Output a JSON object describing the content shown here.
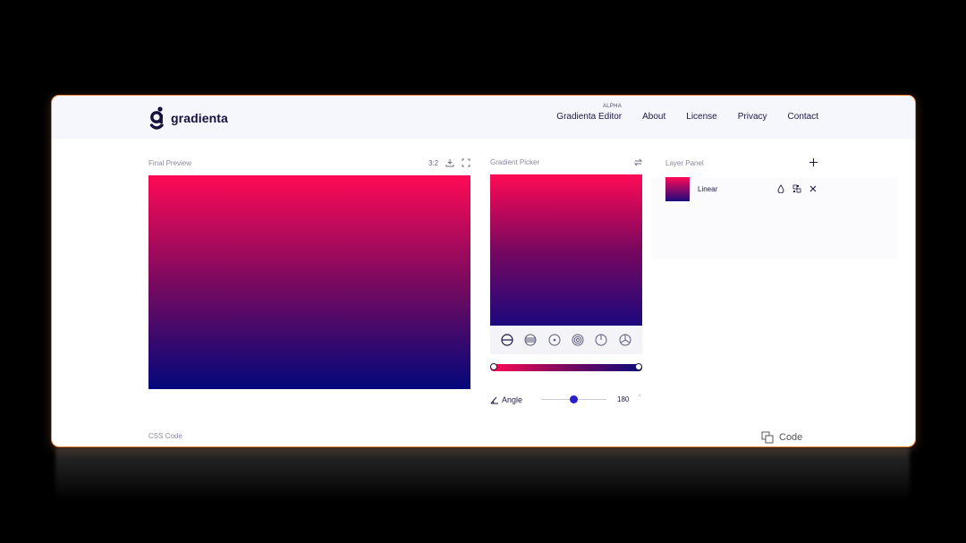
{
  "header": {
    "logo_text": "gradienta",
    "nav": [
      {
        "label": "Gradienta Editor",
        "badge": "ALPHA"
      },
      {
        "label": "About"
      },
      {
        "label": "License"
      },
      {
        "label": "Privacy"
      },
      {
        "label": "Contact"
      }
    ]
  },
  "preview": {
    "label": "Final Preview",
    "ratio": "3:2",
    "gradient_colors": [
      "#ff0a55",
      "#7a0a5f",
      "#03087a"
    ]
  },
  "picker": {
    "label": "Gradient Picker",
    "gradient_types": [
      "linear-icon",
      "repeating-linear-icon",
      "radial-icon",
      "repeating-radial-icon",
      "conic-icon",
      "repeating-conic-icon"
    ],
    "stops": [
      {
        "color": "#ff0a55",
        "position": 0
      },
      {
        "color": "#0a0a7a",
        "position": 100
      }
    ],
    "angle": {
      "label": "Angle",
      "value": "180",
      "unit": "°",
      "fraction": 0.5
    }
  },
  "layers": {
    "label": "Layer Panel",
    "items": [
      {
        "name": "Linear"
      }
    ]
  },
  "css_section": {
    "label": "CSS Code",
    "code_button": "Code"
  },
  "colors": {
    "accent": "#2a1ecf",
    "frame_border": "#f08a3c",
    "text_dark": "#1d1a45"
  }
}
